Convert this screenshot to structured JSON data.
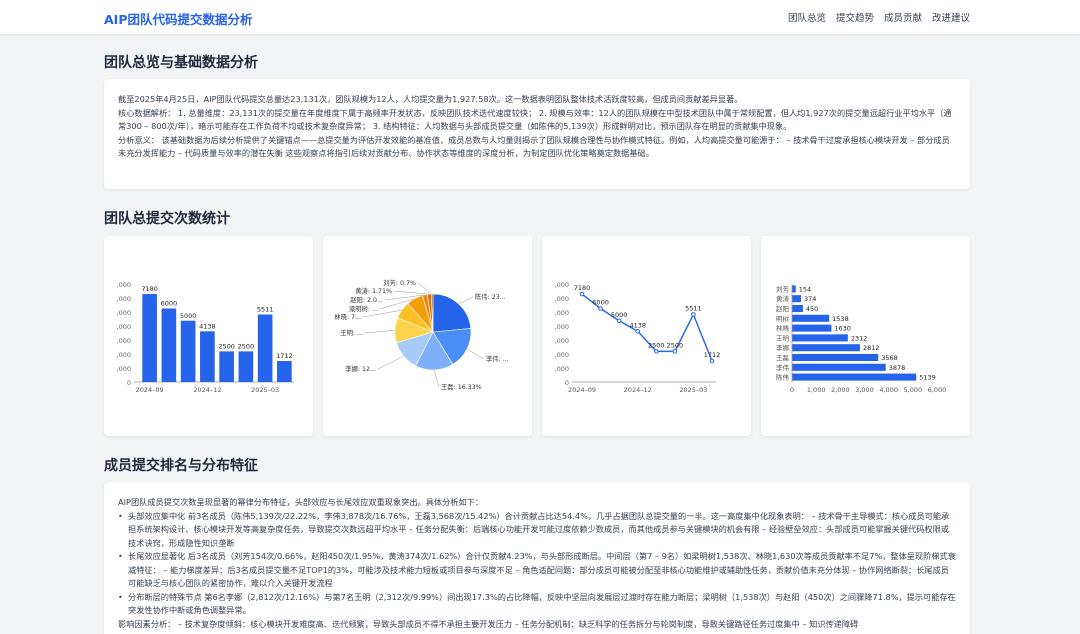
{
  "nav": {
    "brand": "AIP团队代码提交数据分析",
    "links": [
      "团队总览",
      "提交趋势",
      "成员贡献",
      "改进建议"
    ]
  },
  "sections": {
    "overview_title": "团队总览与基础数据分析",
    "stats_title": "团队总提交次数统计",
    "rank_title": "成员提交排名与分布特征"
  },
  "summary": {
    "p1": "截至2025年4月25日，AIP团队代码提交总量达23,131次，团队规模为12人，人均提交量为1,927.58次。这一数据表明团队整体技术活跃度较高，但成员间贡献差异显著。",
    "p2": "核心数据解析： 1. 总量维度：23,131次的提交量在年度维度下属于高频率开发状态，反映团队技术迭代速度较快； 2. 规模与效率：12人的团队规模在中型技术团队中属于常规配置，但人均1,927次的提交量远超行业平均水平（通常300 – 800次/年），暗示可能存在工作负荷不均或技术复杂度异常； 3. 结构特征：人均数据与头部成员提交量（如陈伟的5,139次）形成鲜明对比，预示团队存在明显的贡献集中现象。",
    "p3": "分析意义： 该基础数据为后续分析提供了关键锚点——总提交量为评估开发效能的基准值，成员总数与人均量则揭示了团队规模合理性与协作模式特征。例如，人均高提交量可能源于： – 技术骨干过度承担核心模块开发 – 部分成员未充分发挥能力 – 代码质量与效率的潜在失衡 这些观察点将指引后续对贡献分布、协作状态等维度的深度分析，为制定团队优化策略奠定数据基础。"
  },
  "rank": {
    "intro": "AIP团队成员提交次数呈现显著的幂律分布特征，头部效应与长尾效应双重现象突出。具体分析如下：",
    "b1": "头部效应集中化 前3名成员（陈伟5,139次/22.22%，李伟3,878次/16.76%，王磊3,568次/15.42%）合计贡献占比达54.4%，几乎占据团队总提交量的一半。这一高度集中化现象表明： – 技术骨干主导模式：核心成员可能承担系统架构设计、核心模块开发等高复杂度任务，导致提交次数远超平均水平 – 任务分配失衡：后端核心功能开发可能过度依赖少数成员，而其他成员参与关键模块的机会有限 – 经验壁垒效应：头部成员可能掌握关键代码权限或技术诀窍，形成隐性知识垄断",
    "b2": "长尾效应显著化 后3名成员（刘芳154次/0.66%，赵阳450次/1.95%，黄涛374次/1.62%）合计仅贡献4.23%，与头部形成断层。中间层（第7 – 9名）如梁明树1,538次、林晓1,630次等成员贡献率不足7%，整体呈现阶梯式衰减特征： – 能力梯度差异：后3名成员提交量不足TOP1的3%，可能涉及技术能力短板或项目参与深度不足 – 角色适配问题：部分成员可能被分配至非核心功能维护或辅助性任务，贡献价值未充分体现 – 协作网络断裂：长尾成员可能缺乏与核心团队的紧密协作，难以介入关键开发流程",
    "b3": "分布断层的特殊节点 第6名李娜（2,812次/12.16%）与第7名王明（2,312次/9.99%）间出现17.3%的占比降幅，反映中坚层向发展层过渡时存在能力断层；梁明树（1,538次）与赵阳（450次）之间骤降71.8%，提示可能存在突发性协作中断或角色调整异常。",
    "p_last": "影响因素分析： – 技术复杂度倾斜：核心模块开发难度高、迭代频繁，导致头部成员不得不承担主要开发压力 – 任务分配机制：缺乏科学的任务拆分与轮岗制度，导致关键路径任务过度集中 – 知识传递障碍"
  },
  "chart_data": [
    {
      "type": "bar",
      "categories": [
        "2024-09",
        "2024-10",
        "2024-11",
        "2024-12",
        "2025-01",
        "2025-02",
        "2025-03",
        "2025-04"
      ],
      "values": [
        7180,
        6000,
        5000,
        4138,
        2500,
        2500,
        5511,
        1712
      ],
      "xticks": [
        "2024–09",
        "2024–12",
        "2025–03"
      ],
      "yticks": [
        ",000",
        ",000",
        ",000",
        ",000",
        ",000",
        ",000",
        ",000",
        "0"
      ],
      "ylim": [
        0,
        8000
      ],
      "color": "#2563eb"
    },
    {
      "type": "pie",
      "slices": [
        {
          "label": "陈伟: 23...",
          "value": 5139,
          "color": "#2563eb"
        },
        {
          "label": "李伟: ...",
          "value": 3878,
          "color": "#4b8ef7"
        },
        {
          "label": "王磊: 16.33%",
          "value": 3568,
          "color": "#7fb1fb"
        },
        {
          "label": "李娜: 12...",
          "value": 2812,
          "color": "#a8caf9"
        },
        {
          "label": "王明: ...",
          "value": 2312,
          "color": "#fcd34d"
        },
        {
          "label": "林晓: 7...",
          "value": 1630,
          "color": "#fbbf24"
        },
        {
          "label": "梁明树: ...",
          "value": 1538,
          "color": "#f59e0b"
        },
        {
          "label": "赵阳: 2.0...",
          "value": 450,
          "color": "#ea8a0c"
        },
        {
          "label": "黄涛: 1.71%",
          "value": 374,
          "color": "#d97706"
        },
        {
          "label": "刘芳: 0.7%",
          "value": 154,
          "color": "#b45309"
        }
      ]
    },
    {
      "type": "line",
      "categories": [
        "2024-09",
        "2024-10",
        "2024-11",
        "2024-12",
        "2025-01",
        "2025-02",
        "2025-03",
        "2025-04"
      ],
      "values": [
        7180,
        6000,
        5000,
        4138,
        2500,
        2500,
        5511,
        1712
      ],
      "xticks": [
        "2024–09",
        "2024–12",
        "2025–03"
      ],
      "yticks": [
        ",000",
        ",000",
        ",000",
        ",000",
        ",000",
        ",000",
        ",000",
        "0"
      ],
      "ylim": [
        0,
        8000
      ],
      "color": "#2563eb"
    },
    {
      "type": "bar",
      "orientation": "horizontal",
      "categories": [
        "刘芳",
        "黄涛",
        "赵阳",
        "明树",
        "林晓",
        "王明",
        "李娜",
        "王磊",
        "李伟",
        "陈伟"
      ],
      "values": [
        154,
        374,
        450,
        1538,
        1630,
        2312,
        2812,
        3568,
        3878,
        5139
      ],
      "xticks": [
        "0",
        "1,000",
        "2,000",
        "3,000",
        "4,000",
        "5,000",
        "6,000"
      ],
      "xlim": [
        0,
        6000
      ],
      "color": "#2563eb"
    }
  ]
}
